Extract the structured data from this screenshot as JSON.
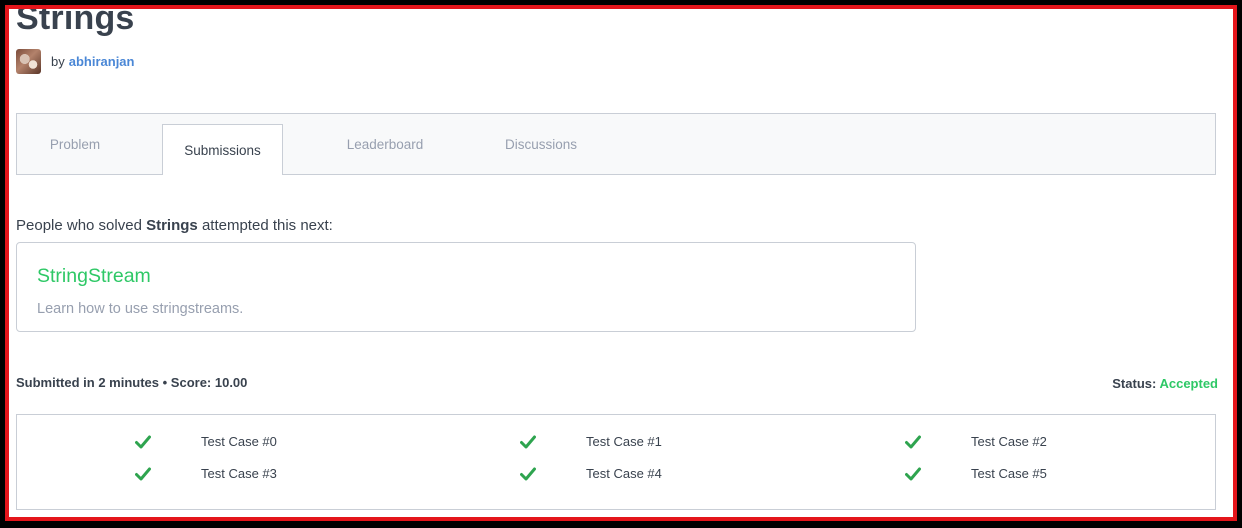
{
  "challenge": {
    "title": "Strings",
    "by_label": "by",
    "author": "abhiranjan"
  },
  "tabs": [
    {
      "label": "Problem"
    },
    {
      "label": "Submissions",
      "active": true
    },
    {
      "label": "Leaderboard"
    },
    {
      "label": "Discussions"
    }
  ],
  "recommendation": {
    "intro_prefix": "People who solved ",
    "intro_challenge": "Strings",
    "intro_suffix": " attempted this next:",
    "title": "StringStream",
    "description": "Learn how to use stringstreams."
  },
  "submission": {
    "summary": "Submitted in 2 minutes • Score: 10.00",
    "status_label": "Status: ",
    "status_value": "Accepted"
  },
  "test_cases": [
    {
      "label": "Test Case #0",
      "passed": true
    },
    {
      "label": "Test Case #1",
      "passed": true
    },
    {
      "label": "Test Case #2",
      "passed": true
    },
    {
      "label": "Test Case #3",
      "passed": true
    },
    {
      "label": "Test Case #4",
      "passed": true
    },
    {
      "label": "Test Case #5",
      "passed": true
    }
  ],
  "colors": {
    "accent_green": "#2ec866",
    "link_blue": "#4a87d6",
    "frame_red": "#e4151b",
    "text_dark": "#39424e",
    "text_muted": "#979faf"
  },
  "icons": {
    "test_passed": "check-icon"
  }
}
